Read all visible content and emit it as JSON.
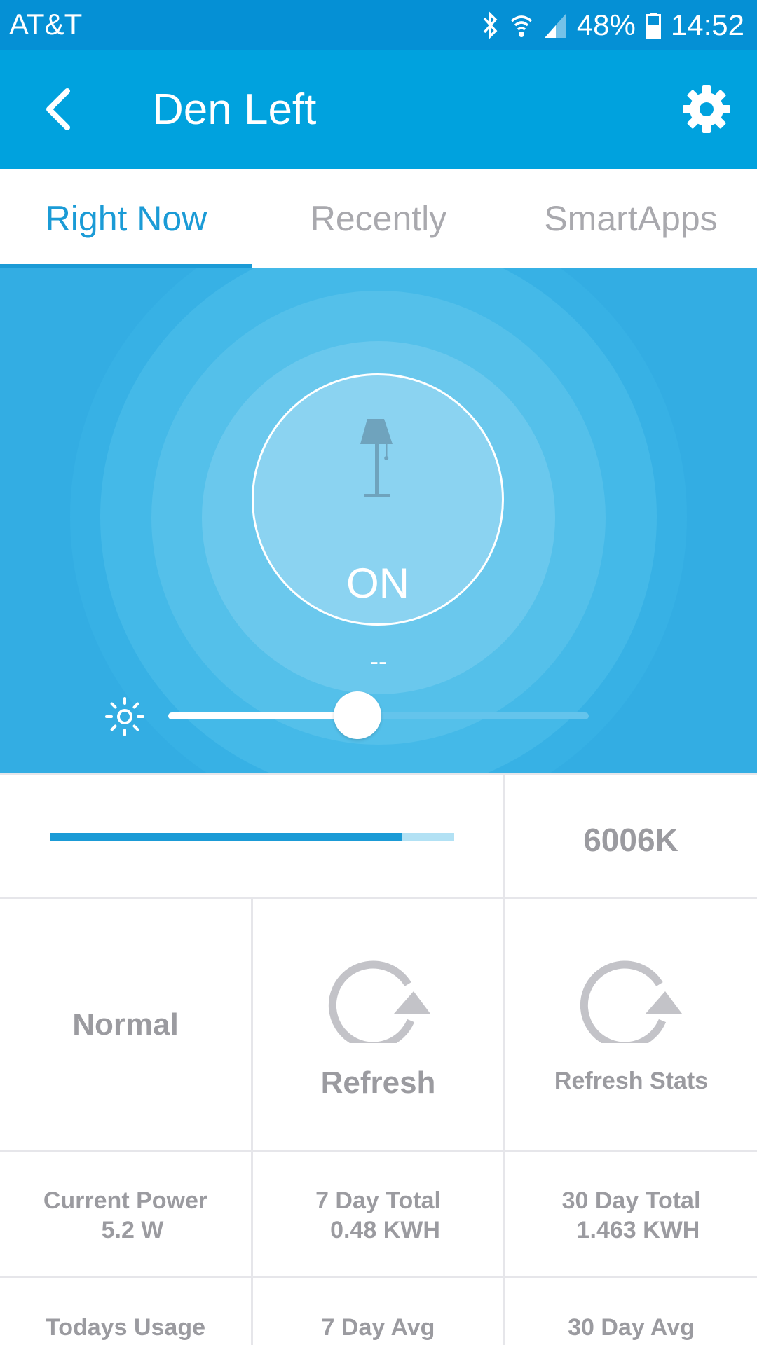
{
  "status_bar": {
    "carrier": "AT&T",
    "battery_percent": "48%",
    "time": "14:52"
  },
  "header": {
    "title": "Den Left"
  },
  "tabs": [
    {
      "label": "Right Now",
      "active": true
    },
    {
      "label": "Recently",
      "active": false
    },
    {
      "label": "SmartApps",
      "active": false
    }
  ],
  "device": {
    "state": "ON",
    "level_text": "--",
    "brightness_level": 0.45
  },
  "color_temperature": {
    "slider_level": 0.87,
    "value": "6006K"
  },
  "tiles": {
    "mode": "Normal",
    "refresh": "Refresh",
    "refresh_stats": "Refresh Stats"
  },
  "stats": {
    "current_power_label": "Current Power",
    "current_power_value": "5.2 W",
    "seven_day_total_label": "7 Day Total",
    "seven_day_total_value": "0.48 KWH",
    "thirty_day_total_label": "30 Day Total",
    "thirty_day_total_value": "1.463 KWH",
    "todays_usage_label": "Todays Usage",
    "seven_day_avg_label": "7 Day Avg",
    "thirty_day_avg_label": "30 Day Avg"
  },
  "colors": {
    "status_bar": "#0590d5",
    "app_bar": "#00a2de",
    "accent": "#1b9bd6",
    "hero_background": "#33ade3",
    "tile_text": "#9b9ba0"
  },
  "icons": {
    "back": "chevron-left-icon",
    "settings": "gear-icon",
    "device": "floor-lamp-icon",
    "brightness": "sun-icon",
    "refresh": "refresh-icon"
  }
}
